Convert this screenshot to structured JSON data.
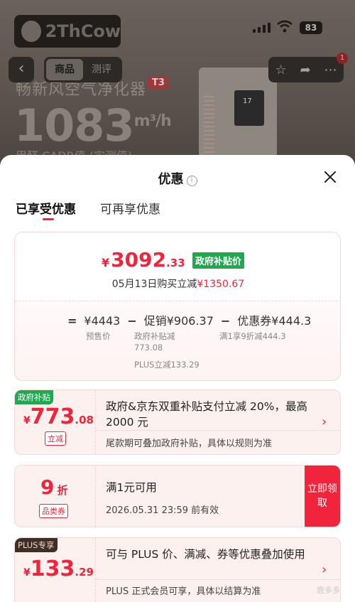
{
  "status_bar": {
    "battery": "83"
  },
  "background_page": {
    "logo_text": "2ThCow",
    "heading": "畅新风空气净化器",
    "model_tag": "T3",
    "big_number": "1083",
    "big_unit": "m³/h",
    "subtext": "甲醛 CADR值 (实测值)"
  },
  "nav": {
    "back": "‹",
    "tabs": [
      {
        "label": "商品"
      },
      {
        "label": "测评"
      }
    ],
    "badge": "1"
  },
  "sheet": {
    "title": "优惠",
    "info": "i",
    "sub_tabs": [
      {
        "label": "已享受优惠"
      },
      {
        "label": "可再享优惠"
      }
    ]
  },
  "price_summary": {
    "currency": "¥",
    "final_int": "3092",
    "final_dec": ".33",
    "gov_tag": "政府补贴价",
    "date_text": "05月13日购买立减",
    "date_amount": "¥1350.67",
    "formula": {
      "eq": "=",
      "presale": "¥4443",
      "minus1": "−",
      "promo": "促销¥906.37",
      "minus2": "−",
      "coupon": "优惠券¥444.3"
    },
    "labels": {
      "presale": "预售价",
      "promo_line1": "政府补贴减",
      "promo_line2": "773.08",
      "promo_line3": "PLUS立减133.29",
      "coupon": "满1享9折减444.3"
    }
  },
  "coupons": [
    {
      "tag": "政府补贴",
      "amount_cur": "¥",
      "amount_int": "773",
      "amount_dec": ".08",
      "small_tag": "立减",
      "title": "政府&京东双重补贴支付立减 20%，最高 2000 元",
      "subtitle": "尾款期可叠加政府补贴，具体以规则为准"
    },
    {
      "amount_int": "9",
      "amount_unit": "折",
      "small_tag": "品类券",
      "title": "满1元可用",
      "subtitle": "2026.05.31 23:59 前有效",
      "button": "立即领取"
    },
    {
      "tag": "PLUS专享",
      "amount_cur": "¥",
      "amount_int": "133",
      "amount_dec": ".29",
      "title": "可与 PLUS 价、满减、券等优惠叠加使用",
      "subtitle": "PLUS 正式会员可享，具体以结算为准"
    }
  ],
  "watermark": "鹿多多",
  "colors": {
    "accent": "#f0243a",
    "gov_green": "#1fa84d",
    "plus_dark": "#3e2e28"
  },
  "icons": [
    "back-icon",
    "info-icon",
    "close-icon",
    "star-icon",
    "share-icon",
    "more-icon",
    "chevron-right-icon",
    "signal-icon",
    "wifi-icon",
    "battery-icon"
  ]
}
